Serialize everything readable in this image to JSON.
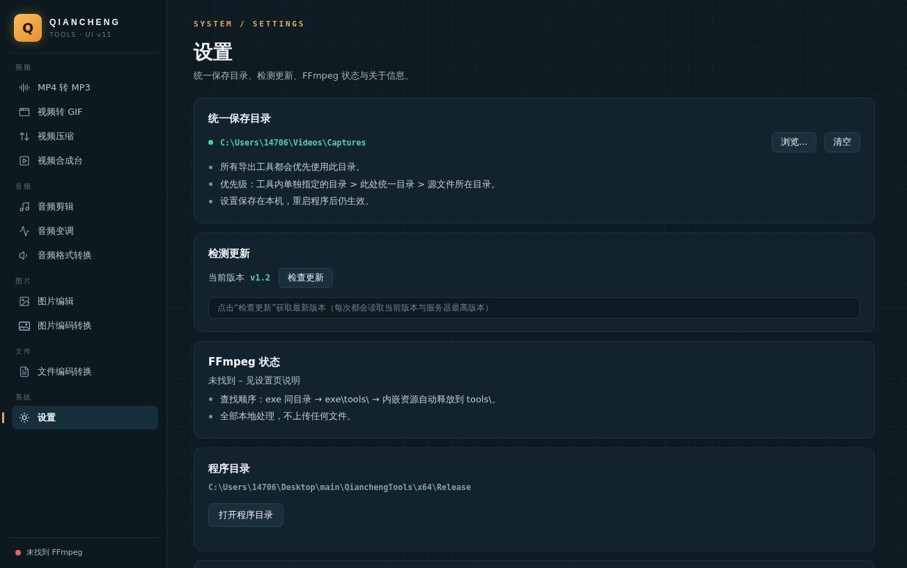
{
  "sidebar": {
    "logo": {
      "letter": "Q",
      "title": "QIANCHENG",
      "subtitle": "TOOLS · UI v11"
    },
    "sections": [
      {
        "label": "视频",
        "items": [
          {
            "label": "MP4 转 MP3",
            "selected": false
          },
          {
            "label": "视频转 GIF",
            "selected": false
          },
          {
            "label": "视频压缩",
            "selected": false
          },
          {
            "label": "视频合成台",
            "selected": false
          }
        ]
      },
      {
        "label": "音频",
        "items": [
          {
            "label": "音频剪辑",
            "selected": false
          },
          {
            "label": "音频变调",
            "selected": false
          },
          {
            "label": "音频格式转换",
            "selected": false
          }
        ]
      },
      {
        "label": "图片",
        "items": [
          {
            "label": "图片编辑",
            "selected": false
          },
          {
            "label": "图片编码转换",
            "selected": false
          }
        ]
      },
      {
        "label": "文件",
        "items": [
          {
            "label": "文件编码转换",
            "selected": false
          }
        ]
      },
      {
        "label": "系统",
        "items": [
          {
            "label": "设置",
            "selected": true
          }
        ]
      }
    ],
    "footer": {
      "text": "未找到 FFmpeg",
      "ok": false
    }
  },
  "header": {
    "breadcrumb": "SYSTEM / SETTINGS",
    "title": "设置",
    "subtitle": "统一保存目录、检测更新、FFmpeg 状态与关于信息。"
  },
  "cards": [
    {
      "kind": "save_directory",
      "title": "统一保存目录",
      "path": "C:\\Users\\14706\\Videos\\Captures",
      "path_ok": true,
      "buttons": [
        "浏览...",
        "清空"
      ],
      "notes": [
        "所有导出工具都会优先使用此目录。",
        "优先级：工具内单独指定的目录 > 此处统一目录 > 源文件所在目录。",
        "设置保存在本机，重启程序后仍生效。"
      ]
    },
    {
      "kind": "update",
      "title": "检测更新",
      "version_label": "当前版本",
      "version": "v1.2",
      "button": "检查更新",
      "placeholder": "点击“检查更新”获取最新版本（每次都会读取当前版本与服务器最高版本）"
    },
    {
      "kind": "ffmpeg",
      "title": "FFmpeg 状态",
      "status": "未找到 – 见设置页说明",
      "notes": [
        "查找顺序：exe 同目录 → exe\\tools\\ → 内嵌资源自动释放到 tools\\。",
        "全部本地处理，不上传任何文件。"
      ]
    },
    {
      "kind": "program_directory",
      "title": "程序目录",
      "path": "C:\\Users\\14706\\Desktop\\main\\QianchengTools\\x64\\Release",
      "button": "打开程序目录"
    }
  ]
}
